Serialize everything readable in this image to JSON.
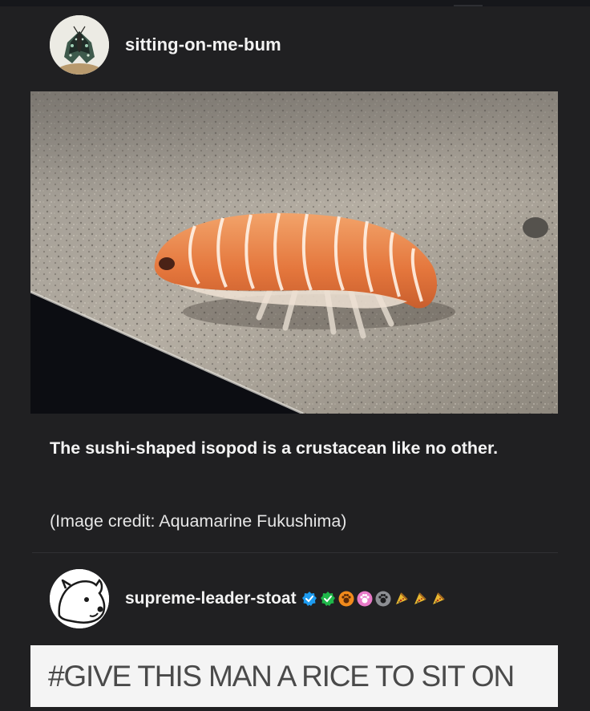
{
  "post": {
    "author": "sitting-on-me-bum",
    "avatar_icon": "moth-avatar-icon",
    "image_icon": "sushi-isopod-photo",
    "caption": "The sushi-shaped isopod is a crustacean like no other.",
    "credit": "(Image credit: Aquamarine Fukushima)"
  },
  "reblog": {
    "author": "supreme-leader-stoat",
    "avatar_icon": "stoat-avatar-icon",
    "badges": [
      {
        "icon": "verified-blue-badge-icon",
        "color": "#1d9bf0"
      },
      {
        "icon": "verified-green-badge-icon",
        "color": "#1fb84a"
      },
      {
        "icon": "paw-orange-badge-icon",
        "color": "#f08a1c"
      },
      {
        "icon": "paw-pink-badge-icon",
        "color": "#e87ac8"
      },
      {
        "icon": "paw-gray-badge-icon",
        "color": "#8d8f94"
      },
      {
        "icon": "pizza-slice-icon",
        "color": "#e8b830"
      },
      {
        "icon": "pizza-slice-icon",
        "color": "#e8b830"
      },
      {
        "icon": "pizza-slice-icon",
        "color": "#e8b830"
      }
    ],
    "tag": "#GIVE THIS MAN A RICE TO SIT ON"
  },
  "colors": {
    "background": "#202022",
    "text": "#f2f2f2",
    "tag_background": "#f4f4f4",
    "tag_text": "#4a4a4a"
  }
}
